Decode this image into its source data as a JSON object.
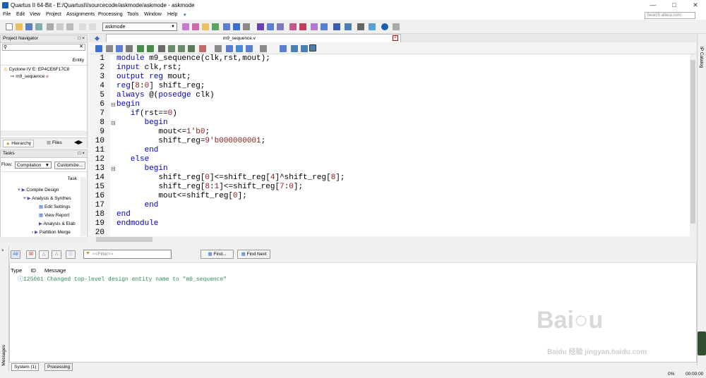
{
  "window": {
    "title": "Quartus II 64-Bit - E:/QuartusII/sourcecode/askmode/askmode - askmode"
  },
  "menu": [
    "File",
    "Edit",
    "View",
    "Project",
    "Assignments",
    "Processing",
    "Tools",
    "Window",
    "Help"
  ],
  "search": {
    "placeholder": "Search altera.com"
  },
  "entity_select": {
    "value": "askmode"
  },
  "project_navigator": {
    "title": "Project Navigator",
    "entity_header": "Entity",
    "device": "Cyclone IV E: EP4CE6F17C8",
    "top_entity": "m9_sequence",
    "tabs": [
      "Hierarchy",
      "Files"
    ]
  },
  "tasks": {
    "title": "Tasks",
    "flow_label": "Flow:",
    "flow_value": "Compilation",
    "customize": "Customize...",
    "task_header": "Task",
    "items": [
      "Compile Design",
      "Analysis & Synthes",
      "Edit Settings",
      "View Report",
      "Analysis & Elab",
      "Partition Merge"
    ]
  },
  "editor": {
    "tab_label": "m9_sequence.v",
    "lines": [
      {
        "n": "1",
        "text": "module m9_sequence(clk,rst,mout);"
      },
      {
        "n": "2",
        "text": "input clk,rst;"
      },
      {
        "n": "3",
        "text": "output reg mout;"
      },
      {
        "n": "4",
        "text": "reg[8:0] shift_reg;"
      },
      {
        "n": "5",
        "text": "always @(posedge clk)"
      },
      {
        "n": "6",
        "text": "begin"
      },
      {
        "n": "7",
        "text": "   if(rst==0)"
      },
      {
        "n": "8",
        "text": "      begin"
      },
      {
        "n": "9",
        "text": "         mout<=1'b0;"
      },
      {
        "n": "10",
        "text": "         shift_reg=9'b000000001;"
      },
      {
        "n": "11",
        "text": "      end"
      },
      {
        "n": "12",
        "text": "   else"
      },
      {
        "n": "13",
        "text": "      begin"
      },
      {
        "n": "14",
        "text": "         shift_reg[0]<=shift_reg[4]^shift_reg[8];"
      },
      {
        "n": "15",
        "text": "         shift_reg[8:1]<=shift_reg[7:0];"
      },
      {
        "n": "16",
        "text": "         mout<=shift_reg[0];"
      },
      {
        "n": "17",
        "text": "      end"
      },
      {
        "n": "18",
        "text": "end"
      },
      {
        "n": "19",
        "text": "endmodule"
      },
      {
        "n": "20",
        "text": ""
      }
    ]
  },
  "ip_catalog": "IP Catalog",
  "messages": {
    "filter_placeholder": "<<Filter>>",
    "find": "Find...",
    "find_next": "Find Next",
    "all_label": "All",
    "columns": [
      "Type",
      "ID",
      "Message"
    ],
    "rows": [
      {
        "id": "125061",
        "text": "Changed top-level design entity name to \"m9_sequence\""
      }
    ],
    "side_label": "Messages",
    "tabs": [
      "System (1)",
      "Processing"
    ]
  },
  "status": {
    "progress": "0%",
    "time": "00:00:00"
  },
  "watermark": "Baidu 经验 jingyan.baidu.com",
  "colors": {
    "keyword": "#0000c8",
    "message_text": "#2e8b57",
    "accent": "#1a5fb4"
  }
}
